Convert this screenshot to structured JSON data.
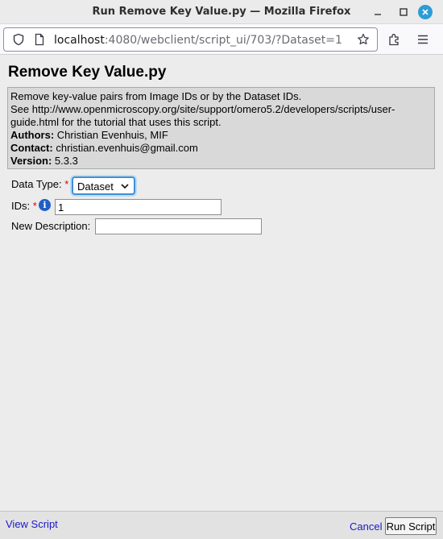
{
  "window": {
    "title": "Run Remove Key Value.py — Mozilla Firefox"
  },
  "browser": {
    "url_host": "localhost",
    "url_rest": ":4080/webclient/script_ui/703/?Dataset=1"
  },
  "script": {
    "title": "Remove Key Value.py",
    "description_line1": "Remove key-value pairs from Image IDs or by the Dataset IDs.",
    "description_line2": "See http://www.openmicroscopy.org/site/support/omero5.2/developers/scripts/user-guide.html for the tutorial that uses this script.",
    "authors_label": "Authors:",
    "authors_value": "Christian Evenhuis, MIF",
    "contact_label": "Contact:",
    "contact_value": "christian.evenhuis@gmail.com",
    "version_label": "Version:",
    "version_value": "5.3.3"
  },
  "form": {
    "data_type_label": "Data Type:",
    "data_type_required": "*",
    "data_type_value": "Dataset",
    "ids_label": "IDs:",
    "ids_required": "*",
    "ids_info_icon": "i",
    "ids_value": "1",
    "new_description_label": "New Description:",
    "new_description_value": ""
  },
  "footer": {
    "view_script_label": "View Script",
    "cancel_label": "Cancel",
    "run_script_label": "Run Script"
  },
  "colors": {
    "link": "#1a1ac8",
    "required": "#dd0000",
    "focus_ring": "#3f8fd4",
    "close_button": "#2e9cd6"
  }
}
